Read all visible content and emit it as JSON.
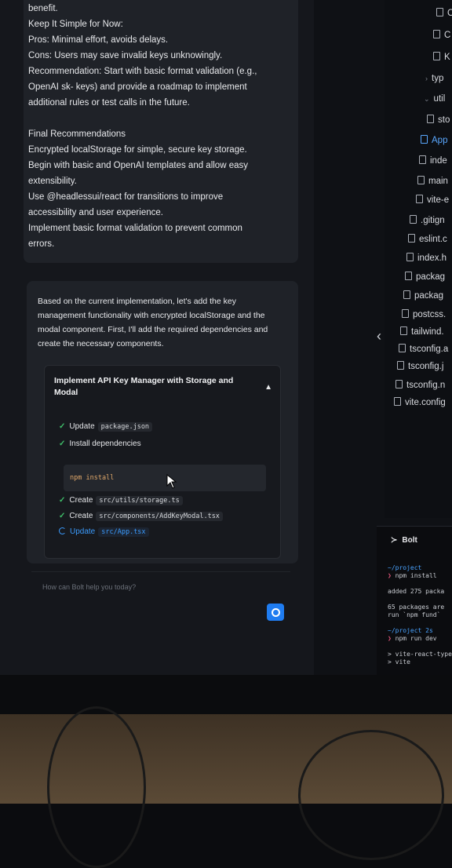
{
  "card1": {
    "lines": [
      "benefit.",
      "Keep It Simple for Now:",
      "Pros: Minimal effort, avoids delays.",
      "Cons: Users may save invalid keys unknowingly.",
      "Recommendation: Start with basic format validation (e.g.,",
      "OpenAI sk- keys) and provide a roadmap to implement",
      "additional rules or test calls in the future.",
      "",
      "Final Recommendations",
      "Encrypted localStorage for simple, secure key storage.",
      "Begin with basic and OpenAI templates and allow easy",
      "extensibility.",
      "Use @headlessui/react for transitions to improve",
      "accessibility and user experience.",
      "Implement basic format validation to prevent common",
      "errors."
    ]
  },
  "card2": {
    "lines": [
      "Based on the current implementation, let's add the key",
      "management functionality with encrypted localStorage and the",
      "modal component. First, I'll add the required dependencies and",
      "create the necessary components."
    ]
  },
  "artifact": {
    "title_line1": "Implement API Key Manager with Storage and",
    "title_line2": "Modal",
    "steps": [
      {
        "verb": "Update",
        "code": "package.json",
        "state": "done"
      },
      {
        "verb": "Install dependencies",
        "code": "",
        "state": "done"
      },
      {
        "verb": "Create",
        "code": "src/utils/storage.ts",
        "state": "done"
      },
      {
        "verb": "Create",
        "code": "src/components/AddKeyModal.tsx",
        "state": "done"
      },
      {
        "verb": "Update",
        "code": "src/App.tsx",
        "state": "active"
      }
    ],
    "command": "npm install"
  },
  "chat_input": {
    "placeholder": "How can Bolt help you today?"
  },
  "files": [
    {
      "name": "C",
      "type": "file"
    },
    {
      "name": "C",
      "type": "file"
    },
    {
      "name": "K",
      "type": "file"
    },
    {
      "name": "typ",
      "type": "folder"
    },
    {
      "name": "util",
      "type": "folder"
    },
    {
      "name": "sto",
      "type": "file"
    },
    {
      "name": "App",
      "type": "file",
      "selected": true
    },
    {
      "name": "inde",
      "type": "file"
    },
    {
      "name": "main",
      "type": "file"
    },
    {
      "name": "vite-e",
      "type": "file"
    },
    {
      "name": ".gitign",
      "type": "file"
    },
    {
      "name": "eslint.c",
      "type": "file"
    },
    {
      "name": "index.h",
      "type": "file"
    },
    {
      "name": "packag",
      "type": "file"
    },
    {
      "name": "packag",
      "type": "file"
    },
    {
      "name": "postcss.",
      "type": "file"
    },
    {
      "name": "tailwind.",
      "type": "file"
    },
    {
      "name": "tsconfig.a",
      "type": "file"
    },
    {
      "name": "tsconfig.j",
      "type": "file"
    },
    {
      "name": "tsconfig.n",
      "type": "file"
    },
    {
      "name": "vite.config",
      "type": "file"
    }
  ],
  "terminal": {
    "tab": "Bolt",
    "path1": "~/project",
    "cmd1": "npm install",
    "out1": "added 275 packa",
    "out2": "65 packages are",
    "out3": "run `npm fund`",
    "path2": "~/project 2s",
    "cmd2": "npm run dev",
    "out4": "vite-react-type",
    "out5": "vite"
  }
}
